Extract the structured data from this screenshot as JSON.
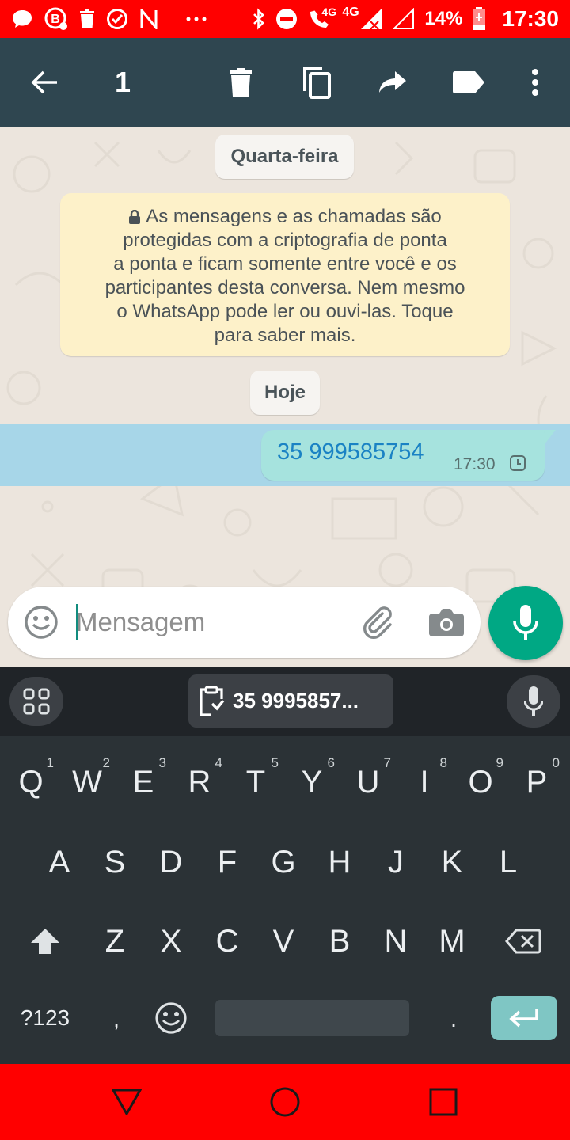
{
  "status_bar": {
    "network_label": "4G",
    "network_label_2": "4G",
    "battery": "14%",
    "time": "17:30",
    "icons": [
      "chat-bubble-icon",
      "b-badge-icon",
      "trash-icon",
      "check-circle-icon",
      "n-logo-icon",
      "more-dots-icon",
      "bluetooth-icon",
      "do-not-disturb-icon",
      "wifi-calling-icon",
      "signal-icon",
      "signal-empty-icon",
      "battery-icon"
    ]
  },
  "action_bar": {
    "selected_count": "1",
    "icons": [
      "back-arrow-icon",
      "delete-icon",
      "copy-icon",
      "forward-icon",
      "label-icon",
      "overflow-menu-icon"
    ]
  },
  "chat": {
    "date_chip_1": "Quarta-feira",
    "encryption_notice": [
      "As mensagens e as chamadas são",
      "protegidas com a criptografia de ponta",
      "a ponta e ficam somente entre você e os",
      "participantes desta conversa. Nem mesmo",
      "o WhatsApp pode ler ou ouvi-las. Toque",
      "para saber mais."
    ],
    "date_chip_2": "Hoje",
    "message": {
      "text": "35 999585754",
      "time": "17:30",
      "status_icon": "pending-clock-icon"
    }
  },
  "composer": {
    "placeholder": "Mensagem",
    "icons": [
      "emoji-icon",
      "attach-clip-icon",
      "camera-icon",
      "mic-icon"
    ]
  },
  "keyboard": {
    "suggestion_chip": "35 9995857...",
    "row1": [
      {
        "k": "Q",
        "h": "1"
      },
      {
        "k": "W",
        "h": "2"
      },
      {
        "k": "E",
        "h": "3"
      },
      {
        "k": "R",
        "h": "4"
      },
      {
        "k": "T",
        "h": "5"
      },
      {
        "k": "Y",
        "h": "6"
      },
      {
        "k": "U",
        "h": "7"
      },
      {
        "k": "I",
        "h": "8"
      },
      {
        "k": "O",
        "h": "9"
      },
      {
        "k": "P",
        "h": "0"
      }
    ],
    "row2": [
      "A",
      "S",
      "D",
      "F",
      "G",
      "H",
      "J",
      "K",
      "L"
    ],
    "row3": [
      "Z",
      "X",
      "C",
      "V",
      "B",
      "N",
      "M"
    ],
    "symbols_key": "?123",
    "comma_key": ",",
    "period_key": "."
  },
  "colors": {
    "status_bar": "#ff0000",
    "action_bar": "#2f4650",
    "fab": "#00a884",
    "bubble": "#a6e3de",
    "selection": "#a7d6e8",
    "encryption_box": "#fdf1c9"
  }
}
